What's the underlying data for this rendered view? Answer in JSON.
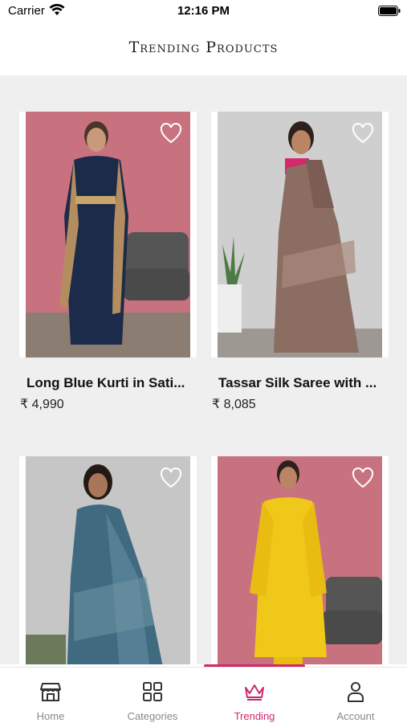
{
  "status_bar": {
    "carrier": "Carrier",
    "time": "12:16 PM"
  },
  "header": {
    "title": "Trending Products"
  },
  "products": [
    {
      "name": "Long Blue Kurti in Sati...",
      "price": "₹ 4,990",
      "image": "woman in long navy blue kurti with golden dupatta against pink backdrop"
    },
    {
      "name": "Tassar Silk Saree with ...",
      "price": "₹ 8,085",
      "image": "woman in printed brown tassar silk saree with pink blouse against grey wall"
    },
    {
      "name": "",
      "price": "",
      "image": "woman in blue printed saree against grey wall"
    },
    {
      "name": "",
      "price": "",
      "image": "woman in yellow embroidered outfit against pink backdrop"
    }
  ],
  "tabs": [
    {
      "label": "Home",
      "icon": "store-icon",
      "active": false
    },
    {
      "label": "Categories",
      "icon": "grid-icon",
      "active": false
    },
    {
      "label": "Trending",
      "icon": "crown-icon",
      "active": true
    },
    {
      "label": "Account",
      "icon": "person-icon",
      "active": false
    }
  ],
  "colors": {
    "accent": "#d0286a",
    "background": "#efefef",
    "inactive_tab": "#888888"
  }
}
